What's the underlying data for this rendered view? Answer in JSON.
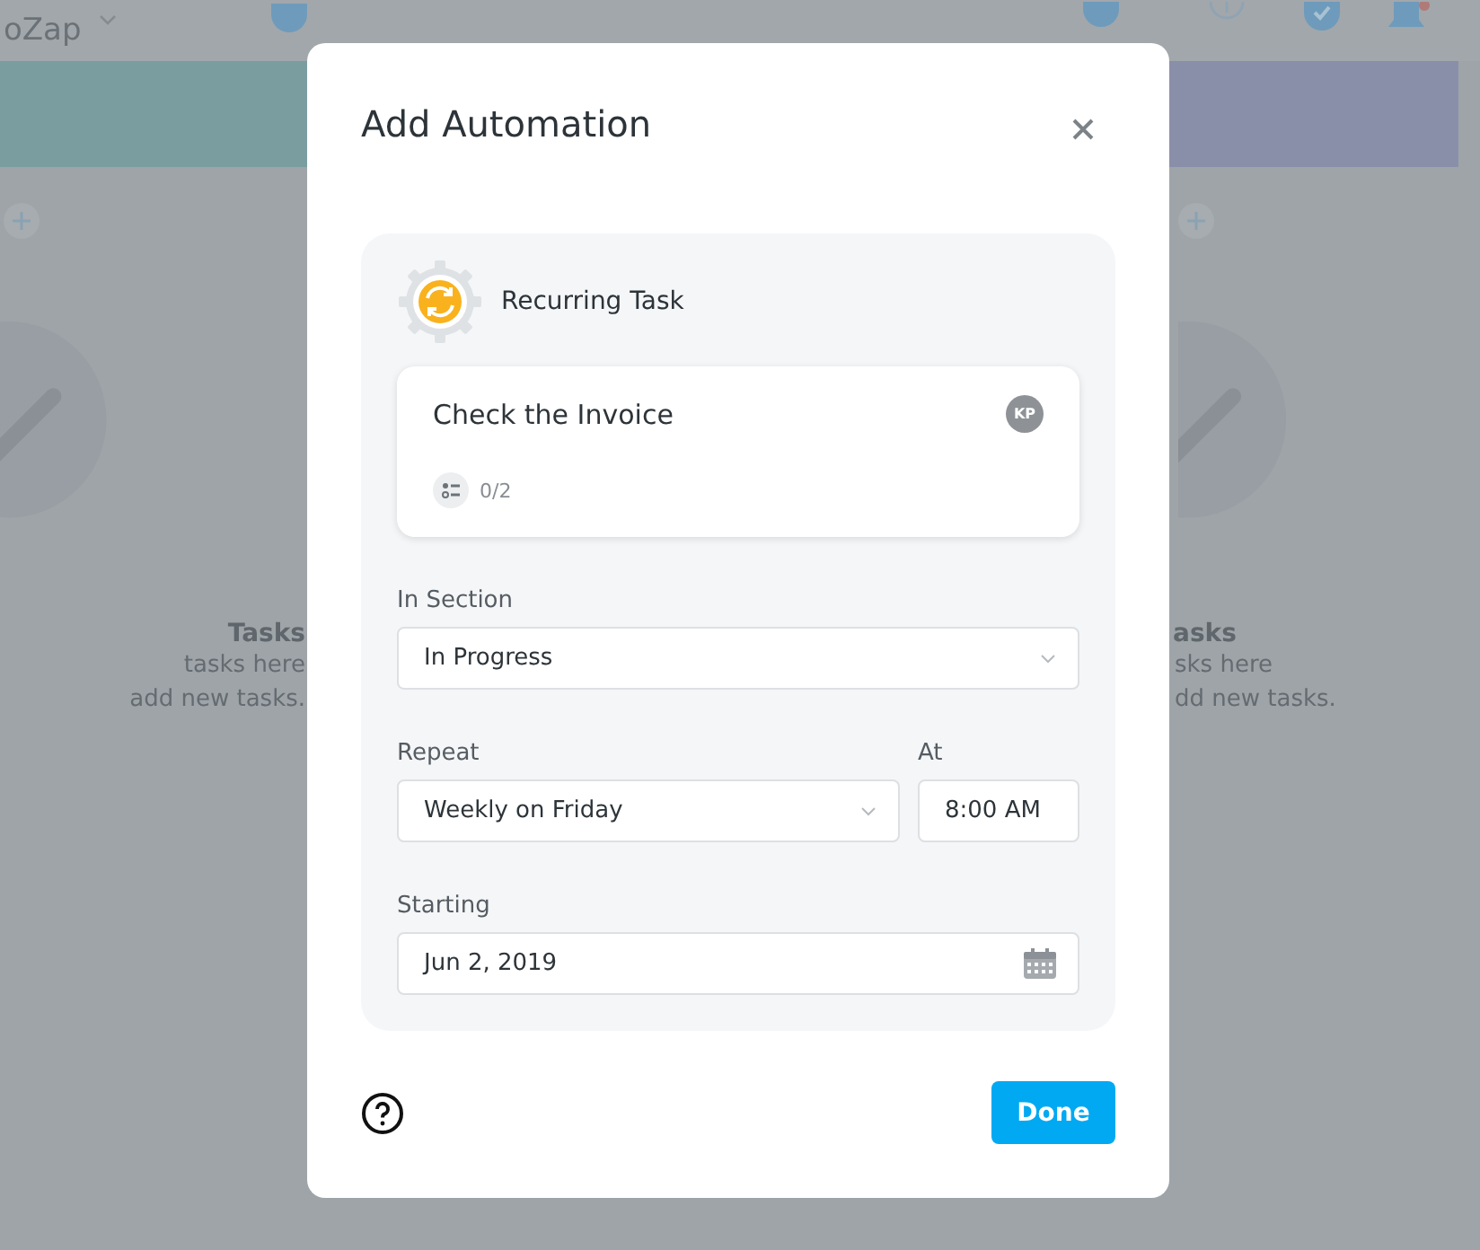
{
  "app_bar": {
    "workspace": "oZap"
  },
  "columns": [
    {
      "title": "Tasks",
      "lines": [
        "tasks here",
        "add new tasks."
      ]
    },
    {
      "title": "asks",
      "lines": [
        "sks here",
        "dd new tasks."
      ]
    }
  ],
  "dialog": {
    "title": "Add Automation",
    "trigger": "Recurring Task",
    "task": {
      "title": "Check the Invoice",
      "assignee": "KP",
      "subtasks": "0/2"
    },
    "fields": [
      {
        "label": "In Section",
        "value": "In Progress",
        "kind": "select"
      }
    ],
    "repeat": {
      "label": "Repeat",
      "value": "Weekly on Friday"
    },
    "at": {
      "label": "At",
      "value": "8:00 AM"
    },
    "starting": {
      "label": "Starting",
      "value": "Jun 2, 2019"
    },
    "done": "Done"
  }
}
